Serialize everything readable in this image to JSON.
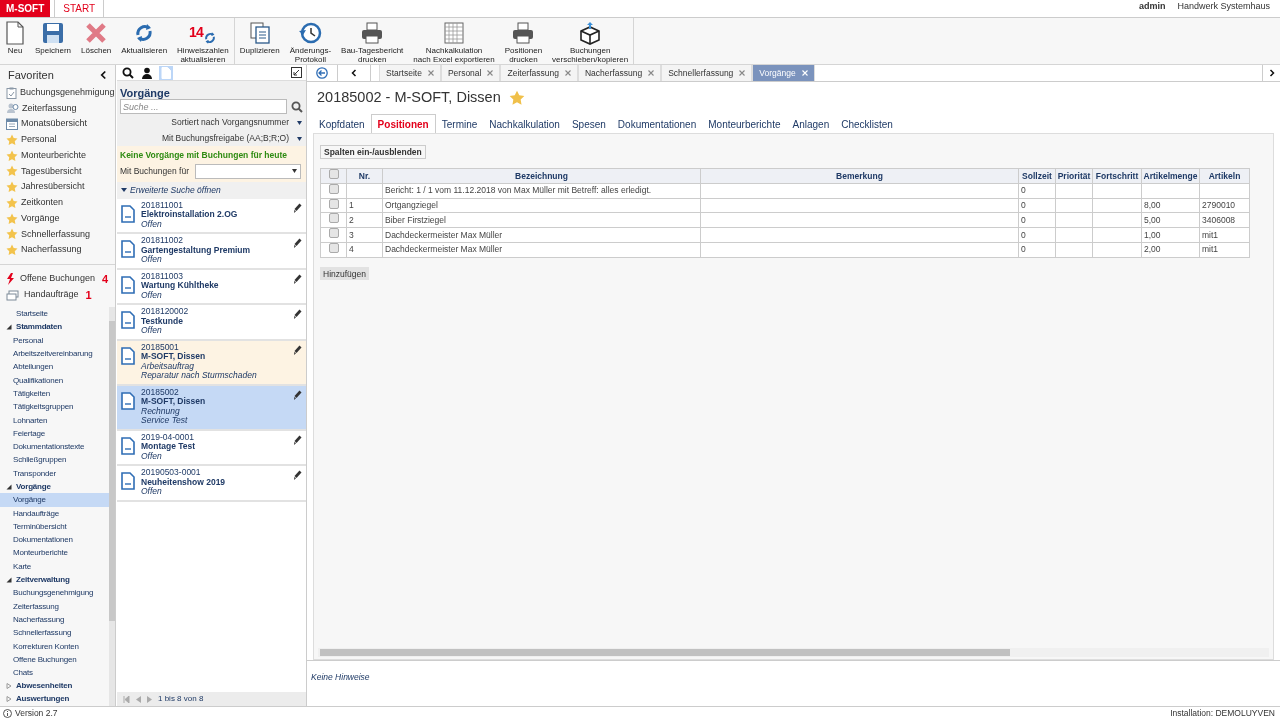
{
  "header": {
    "logo": "M-SOFT",
    "tabs": [
      {
        "label": "START",
        "selected": true
      }
    ],
    "user": "admin",
    "company": "Handwerk Systemhaus"
  },
  "toolbar": {
    "groups": [
      [
        {
          "kind": "new",
          "lines": [
            "Neu"
          ]
        },
        {
          "kind": "save",
          "lines": [
            "Speichern"
          ]
        },
        {
          "kind": "delete",
          "lines": [
            "Löschen"
          ]
        },
        {
          "kind": "refresh",
          "lines": [
            "Aktualisieren"
          ]
        },
        {
          "kind": "counter",
          "badge": "14",
          "lines": [
            "Hinweiszahlen",
            "aktualisieren"
          ]
        }
      ],
      [
        {
          "kind": "copy",
          "lines": [
            "Duplizieren"
          ]
        },
        {
          "kind": "history",
          "lines": [
            "Änderungs-",
            "Protokoll"
          ]
        },
        {
          "kind": "print",
          "lines": [
            "Bau-Tagesbericht",
            "drucken"
          ]
        },
        {
          "kind": "grid",
          "lines": [
            "Nachkalkulation",
            "nach Excel exportieren"
          ]
        },
        {
          "kind": "print",
          "lines": [
            "Positionen",
            "drucken"
          ]
        },
        {
          "kind": "box",
          "lines": [
            "Buchungen",
            "verschieben/kopieren"
          ]
        }
      ]
    ]
  },
  "favorites": {
    "title": "Favoriten",
    "items": [
      {
        "kind": "approval",
        "label": "Buchungsgenehmigung"
      },
      {
        "kind": "time",
        "label": "Zeiterfassung"
      },
      {
        "kind": "calendar",
        "label": "Monatsübersicht"
      },
      {
        "kind": "star",
        "label": "Personal"
      },
      {
        "kind": "star",
        "label": "Monteurberichte"
      },
      {
        "kind": "star",
        "label": "Tagesübersicht"
      },
      {
        "kind": "star",
        "label": "Jahresübersicht"
      },
      {
        "kind": "star",
        "label": "Zeitkonten"
      },
      {
        "kind": "star",
        "label": "Vorgänge"
      },
      {
        "kind": "star",
        "label": "Schnellerfassung"
      },
      {
        "kind": "star",
        "label": "Nacherfassung"
      }
    ]
  },
  "alerts": [
    {
      "kind": "bolt",
      "label": "Offene Buchungen",
      "count": "4"
    },
    {
      "kind": "hand",
      "label": "Handaufträge",
      "count": "1"
    }
  ],
  "nav": [
    {
      "label": "Startseite",
      "selected": false
    },
    {
      "label": "Stammdaten",
      "expanded": true,
      "children": [
        {
          "label": "Personal",
          "selected": false
        },
        {
          "label": "Arbeitszeitvereinbarung",
          "selected": false
        },
        {
          "label": "Abteilungen",
          "selected": false
        },
        {
          "label": "Qualifikationen",
          "selected": false
        },
        {
          "label": "Tätigkeiten",
          "selected": false
        },
        {
          "label": "Tätigkeitsgruppen",
          "selected": false
        },
        {
          "label": "Lohnarten",
          "selected": false
        },
        {
          "label": "Feiertage",
          "selected": false
        },
        {
          "label": "Dokumentationstexte",
          "selected": false
        },
        {
          "label": "Schließgruppen",
          "selected": false
        },
        {
          "label": "Transponder",
          "selected": false
        }
      ]
    },
    {
      "label": "Vorgänge",
      "expanded": true,
      "children": [
        {
          "label": "Vorgänge",
          "selected": true
        },
        {
          "label": "Handaufträge",
          "selected": false
        },
        {
          "label": "Terminübersicht",
          "selected": false
        },
        {
          "label": "Dokumentationen",
          "selected": false
        },
        {
          "label": "Monteurberichte",
          "selected": false
        },
        {
          "label": "Karte",
          "selected": false
        }
      ]
    },
    {
      "label": "Zeitverwaltung",
      "expanded": true,
      "children": [
        {
          "label": "Buchungsgenehmigung",
          "selected": false
        },
        {
          "label": "Zeiterfassung",
          "selected": false
        },
        {
          "label": "Nacherfassung",
          "selected": false
        },
        {
          "label": "Schnellerfassung",
          "selected": false
        },
        {
          "label": "Korrekturen Konten",
          "selected": false
        },
        {
          "label": "Offene Buchungen",
          "selected": false
        },
        {
          "label": "Chats",
          "selected": false
        }
      ]
    },
    {
      "label": "Abwesenheiten",
      "expanded": false
    },
    {
      "label": "Auswertungen",
      "expanded": false
    }
  ],
  "list_panel": {
    "modes": [
      {
        "kind": "search",
        "selected": false
      },
      {
        "kind": "person",
        "selected": false
      },
      {
        "kind": "document",
        "selected": true
      }
    ],
    "title": "Vorgänge",
    "search": {
      "placeholder": "Suche ..."
    },
    "sort": "Sortiert nach Vorgangsnummer",
    "filter": "Mit Buchungsfreigabe (AA;B;R;O)",
    "notice": "Keine Vorgänge mit Buchungen für heute",
    "bookings_label": "Mit Buchungen für",
    "advanced": "Erweiterte Suche öffnen",
    "records": [
      {
        "number": "201811001",
        "title": "Elektroinstallation 2.OG",
        "lines": [
          "Offen"
        ],
        "flagged": false,
        "selected": false
      },
      {
        "number": "201811002",
        "title": "Gartengestaltung Premium",
        "lines": [
          "Offen"
        ],
        "flagged": false,
        "selected": false
      },
      {
        "number": "201811003",
        "title": "Wartung Kühltheke",
        "lines": [
          "Offen"
        ],
        "flagged": false,
        "selected": false
      },
      {
        "number": "2018120002",
        "title": "Testkunde",
        "lines": [
          "Offen"
        ],
        "flagged": false,
        "selected": false
      },
      {
        "number": "20185001",
        "title": "M-SOFT, Dissen",
        "lines": [
          "Arbeitsauftrag",
          "Reparatur nach Sturmschaden"
        ],
        "flagged": true,
        "selected": false
      },
      {
        "number": "20185002",
        "title": "M-SOFT, Dissen",
        "lines": [
          "Rechnung",
          "Service Test"
        ],
        "flagged": false,
        "selected": true
      },
      {
        "number": "2019-04-0001",
        "title": "Montage Test",
        "lines": [
          "Offen"
        ],
        "flagged": false,
        "selected": false
      },
      {
        "number": "20190503-0001",
        "title": "Neuheitenshow 2019",
        "lines": [
          "Offen"
        ],
        "flagged": false,
        "selected": false
      }
    ],
    "pager": "1 bis 8 von 8"
  },
  "open_tabs": [
    {
      "label": "Startseite",
      "selected": false
    },
    {
      "label": "Personal",
      "selected": false
    },
    {
      "label": "Zeiterfassung",
      "selected": false
    },
    {
      "label": "Nacherfassung",
      "selected": false
    },
    {
      "label": "Schnellerfassung",
      "selected": false
    },
    {
      "label": "Vorgänge",
      "selected": true
    }
  ],
  "record": {
    "title": "20185002 - M-SOFT, Dissen",
    "favorite": true,
    "tabs": [
      {
        "label": "Kopfdaten",
        "selected": false
      },
      {
        "label": "Positionen",
        "selected": true
      },
      {
        "label": "Termine",
        "selected": false
      },
      {
        "label": "Nachkalkulation",
        "selected": false
      },
      {
        "label": "Spesen",
        "selected": false
      },
      {
        "label": "Dokumentationen",
        "selected": false
      },
      {
        "label": "Monteurberichte",
        "selected": false
      },
      {
        "label": "Anlagen",
        "selected": false
      },
      {
        "label": "Checklisten",
        "selected": false
      }
    ],
    "columns_button": "Spalten ein-/ausblenden",
    "table": {
      "all_checked": false,
      "columns": [
        "Nr.",
        "Bezeichnung",
        "Bemerkung",
        "Sollzeit",
        "Priorität",
        "Fortschritt",
        "Artikelmenge",
        "Artikeln"
      ],
      "rows": [
        {
          "checked": false,
          "cells": [
            null,
            "Bericht: 1 / 1 vom 11.12.2018 von Max Müller mit Betreff: alles erledigt.",
            null,
            "0",
            null,
            null,
            null,
            null
          ]
        },
        {
          "checked": false,
          "cells": [
            "1",
            "Ortgangziegel",
            null,
            "0",
            null,
            null,
            "8,00",
            "2790010"
          ]
        },
        {
          "checked": false,
          "cells": [
            "2",
            "Biber Firstziegel",
            null,
            "0",
            null,
            null,
            "5,00",
            "3406008"
          ]
        },
        {
          "checked": false,
          "cells": [
            "3",
            "Dachdeckermeister Max Müller",
            null,
            "0",
            null,
            null,
            "1,00",
            "mit1"
          ]
        },
        {
          "checked": false,
          "cells": [
            "4",
            "Dachdeckermeister Max Müller",
            null,
            "0",
            null,
            null,
            "2,00",
            "mit1"
          ]
        }
      ]
    },
    "add_button": "Hinzufügen",
    "hints": "Keine Hinweise"
  },
  "status_bar": {
    "version": "Version 2.7",
    "installation": "Installation: DEMOLUYVEN"
  }
}
